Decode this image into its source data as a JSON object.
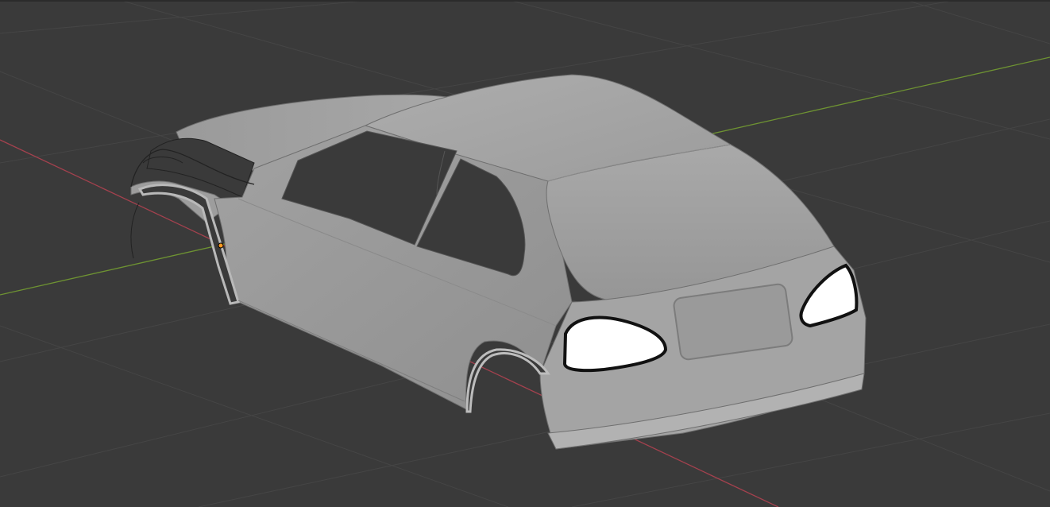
{
  "viewport": {
    "name": "3D Viewport",
    "background": "#3a3a3a",
    "grid_color": "#444444",
    "x_axis_color": "#a4414e",
    "y_axis_color": "#6e9332",
    "object": "car-body-mesh",
    "shading": "solid",
    "mesh_color": "#a6a6a6",
    "light_color": "#ffffff",
    "origin_color": "#ff9a1f"
  }
}
